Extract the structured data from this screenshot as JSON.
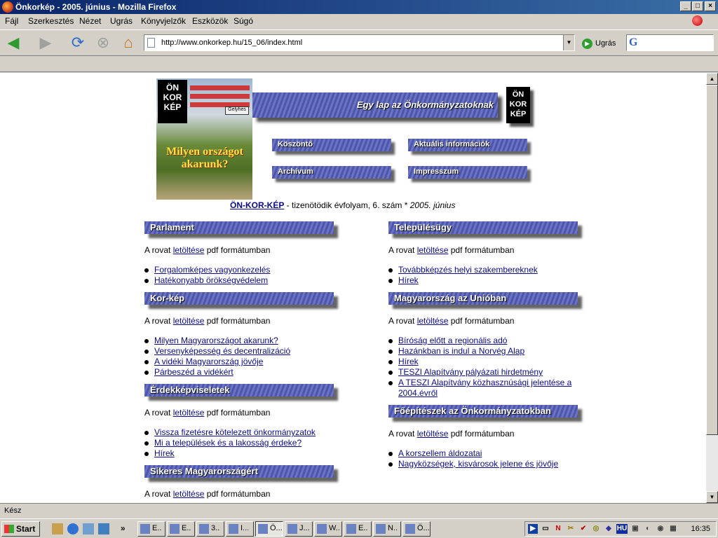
{
  "window": {
    "title": "Önkorkép - 2005. június - Mozilla Firefox",
    "buttons": {
      "minimize": "_",
      "maximize": "□",
      "close": "×"
    }
  },
  "menu": [
    "Fájl",
    "Szerkesztés",
    "Nézet",
    "Ugrás",
    "Könyvjelzők",
    "Eszközök",
    "Súgó"
  ],
  "toolbar": {
    "url": "http://www.onkorkep.hu/15_06/index.html",
    "go_label": "Ugrás",
    "search_engine_glyph": "G",
    "search_placeholder": ""
  },
  "page": {
    "cover": {
      "logo": [
        "ÖN",
        "KOR",
        "KÉP"
      ],
      "headline": "Milyen országot akarunk?",
      "sign_text": "Gelyhes"
    },
    "banner_text": "Egy lap az Önkormányzatoknak",
    "banner_logo": [
      "ÖN",
      "KOR",
      "KÉP"
    ],
    "nav": {
      "koszonto": "Köszöntő",
      "aktualis": "Aktuális információk",
      "archivum": "Archívum",
      "impresszum": "Impresszum"
    },
    "issue": {
      "brand": "ÖN-KOR-KÉP",
      "text": " - tizenötödik évfolyam, 6. szám * ",
      "date": "2005. június"
    },
    "rovat": {
      "prefix": "A rovat ",
      "link": "letöltése",
      "suffix": " pdf formátumban"
    },
    "sections": {
      "parlament": {
        "title": "Parlament",
        "items": [
          "Forgalomképes vagyonkezelés",
          "Hatékonyabb örökségvédelem"
        ]
      },
      "korkep": {
        "title": "Kor-kép",
        "items": [
          "Milyen Magyarországot akarunk?",
          "Versenyképesség és decentralizáció",
          "A vidéki Magyarország jövője",
          "Párbeszéd a vidékért"
        ]
      },
      "erdek": {
        "title": "Érdekképviseletek",
        "items": [
          "Vissza fizetésre kötelezett önkormányzatok",
          "Mi a települések és a lakosság érdeke?",
          "Hírek"
        ]
      },
      "sikeres": {
        "title": "Sikeres Magyarországért",
        "items": []
      },
      "telepules": {
        "title": "Településügy",
        "items": [
          "Továbbképzés helyi szakembereknek",
          "Hírek"
        ]
      },
      "unio": {
        "title": "Magyarország az Unióban",
        "items": [
          "Bíróság előtt a regionális adó",
          "Hazánkban is indul a Norvég Alap",
          "Hírek",
          "TESZI Alapítvány pályázati hirdetmény",
          "A TESZI Alapítvány közhasznúsági jelentése a 2004.évről"
        ]
      },
      "foepitesz": {
        "title": "Főépítészek az Önkormányzatokban",
        "items": [
          "A korszellem áldozatai",
          "Nagyközségek, kisvárosok jelene és jövője"
        ]
      }
    }
  },
  "status": "Kész",
  "taskbar": {
    "start": "Start",
    "buttons": [
      "E..",
      "E..",
      "3..",
      "I...",
      "Ö...",
      "J...",
      "W..",
      "E..",
      "N..",
      "Ö..."
    ],
    "active_index": 4,
    "overflow": "»",
    "clock": "16:35",
    "lang": "HU"
  }
}
